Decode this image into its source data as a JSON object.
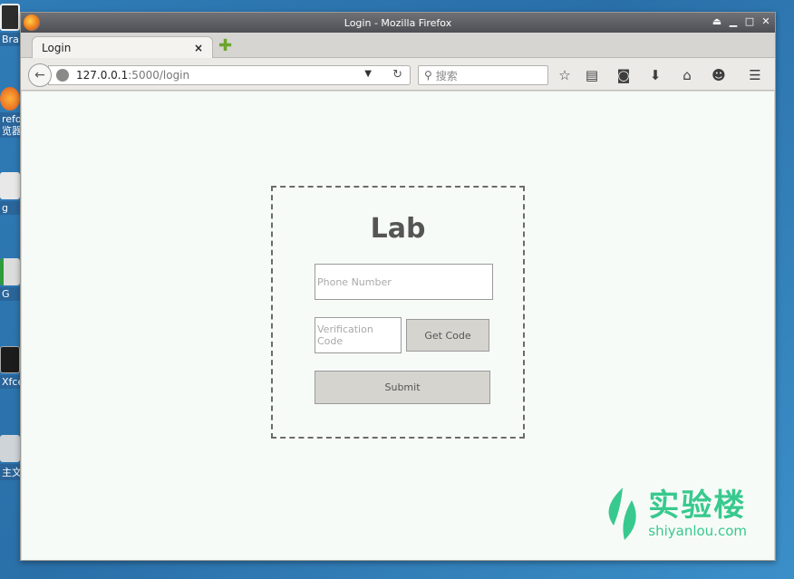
{
  "desktop": {
    "icons": [
      {
        "label": "Bra"
      },
      {
        "label": "refo\n览器"
      },
      {
        "label": "g"
      },
      {
        "label": "G"
      },
      {
        "label": "Xfce"
      },
      {
        "label": "主文"
      }
    ]
  },
  "window": {
    "title": "Login - Mozilla Firefox"
  },
  "tabs": [
    {
      "label": "Login",
      "close": "×"
    }
  ],
  "newtab": "✚",
  "nav": {
    "url_host": "127.0.0.1",
    "url_path": ":5000/login",
    "search_placeholder": "搜索"
  },
  "page": {
    "title": "Lab",
    "phone_placeholder": "Phone Number",
    "code_placeholder": "Verification Code",
    "get_code_label": "Get Code",
    "submit_label": "Submit"
  },
  "watermark": {
    "cn": "实验楼",
    "en": "shiyanlou.com"
  },
  "colors": {
    "accent": "#38c98e",
    "button_bg": "#d6d4cf",
    "page_bg": "#f7fbf8"
  }
}
